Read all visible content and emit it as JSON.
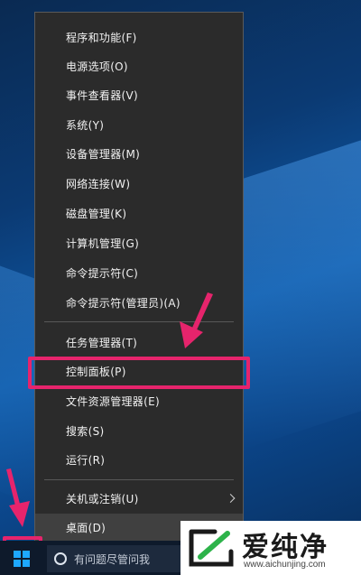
{
  "menu": {
    "items": [
      {
        "label": "程序和功能(F)"
      },
      {
        "label": "电源选项(O)"
      },
      {
        "label": "事件查看器(V)"
      },
      {
        "label": "系统(Y)"
      },
      {
        "label": "设备管理器(M)"
      },
      {
        "label": "网络连接(W)"
      },
      {
        "label": "磁盘管理(K)"
      },
      {
        "label": "计算机管理(G)"
      },
      {
        "label": "命令提示符(C)"
      },
      {
        "label": "命令提示符(管理员)(A)"
      },
      {
        "label": "任务管理器(T)"
      },
      {
        "label": "控制面板(P)"
      },
      {
        "label": "文件资源管理器(E)"
      },
      {
        "label": "搜索(S)"
      },
      {
        "label": "运行(R)"
      },
      {
        "label": "关机或注销(U)",
        "submenu": true
      },
      {
        "label": "桌面(D)"
      }
    ],
    "highlighted_item": "控制面板(P)"
  },
  "taskbar": {
    "start_icon": "windows-logo-icon",
    "search_placeholder": "有问题尽管问我"
  },
  "watermark": {
    "brand": "爱纯净",
    "url": "www.aichunjing.com"
  },
  "annotation_color": "#e6246c",
  "icons": [
    "windows-logo-icon",
    "cortana-icon",
    "chevron-right-icon",
    "arrow-icon",
    "brand-logo-icon"
  ]
}
